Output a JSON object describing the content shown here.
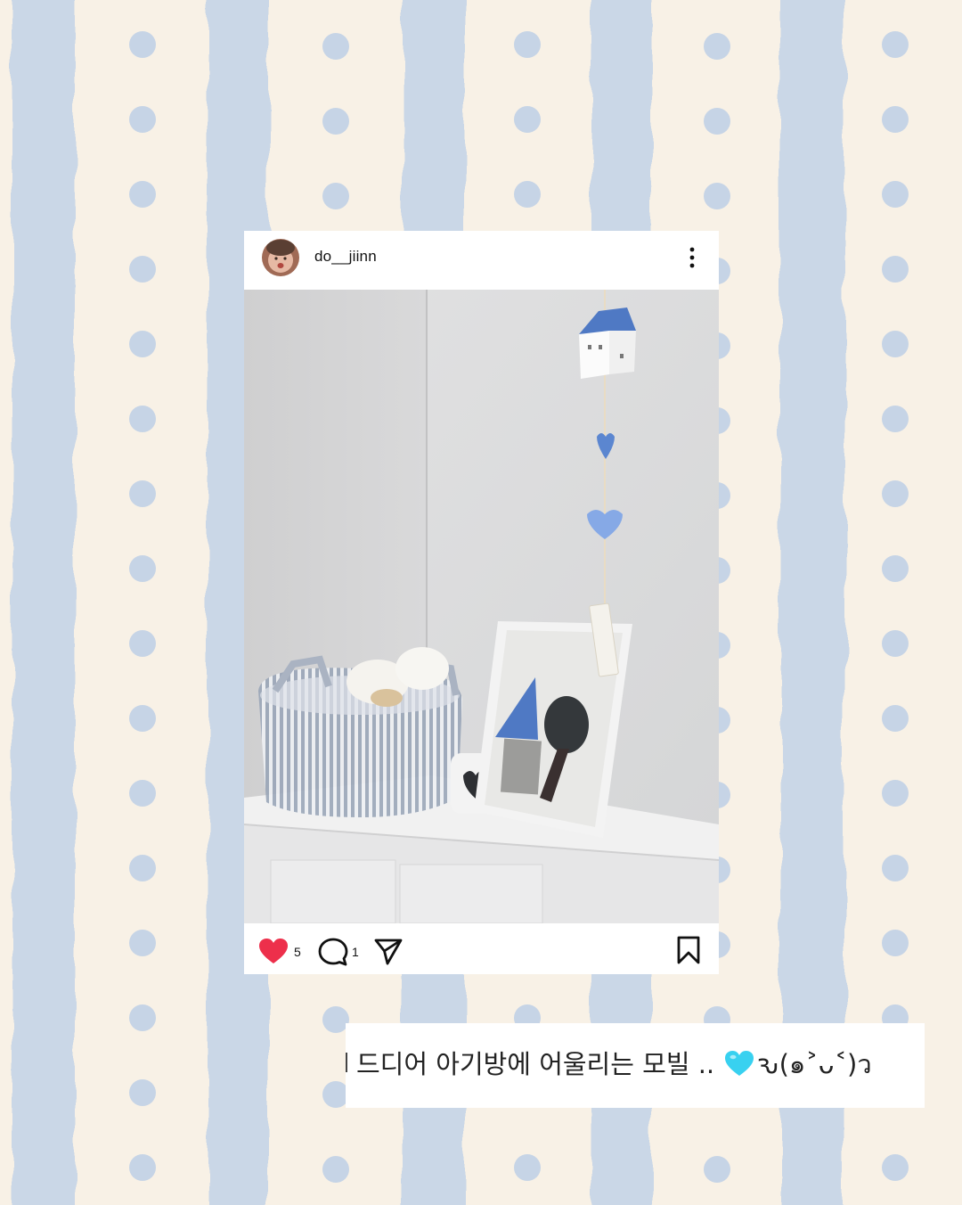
{
  "post": {
    "username": "do__jiinn",
    "likes": "5",
    "comments": "1"
  },
  "caption": {
    "text": "드디어 아기방에 어울리는 모빌 ..",
    "kaomoji": "ԅ(๑˃ᴗ˂)ว"
  },
  "icons": {
    "like": "heart-icon",
    "comment": "comment-icon",
    "share": "send-icon",
    "save": "bookmark-icon",
    "more": "more-vertical-icon"
  },
  "colors": {
    "background": "#f8f1e6",
    "stripe": "#c8d6e8",
    "dot": "#c6d4e6",
    "like_red": "#ed2f4b",
    "cyan_heart": "#38d1f0"
  }
}
